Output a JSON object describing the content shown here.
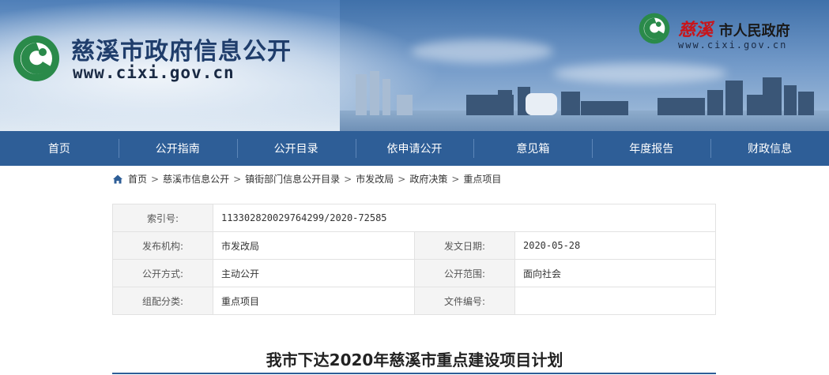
{
  "header": {
    "site_title": "慈溪市政府信息公开",
    "site_url": "www.cixi.gov.cn",
    "city_calligraphy": "慈溪",
    "city_gov": "市人民政府",
    "city_url": "www.cixi.gov.cn",
    "logo_icon": "cixi-logo-icon"
  },
  "nav": {
    "items": [
      {
        "label": "首页"
      },
      {
        "label": "公开指南"
      },
      {
        "label": "公开目录"
      },
      {
        "label": "依申请公开"
      },
      {
        "label": "意见箱"
      },
      {
        "label": "年度报告"
      },
      {
        "label": "财政信息"
      }
    ]
  },
  "breadcrumb": {
    "icon": "home-icon",
    "items": [
      "首页",
      "慈溪市信息公开",
      "镇街部门信息公开目录",
      "市发改局",
      "政府决策",
      "重点项目"
    ]
  },
  "meta": {
    "index_label": "索引号:",
    "index_value": "113302820029764299/2020-72585",
    "org_label": "发布机构:",
    "org_value": "市发改局",
    "date_label": "发文日期:",
    "date_value": "2020-05-28",
    "method_label": "公开方式:",
    "method_value": "主动公开",
    "scope_label": "公开范围:",
    "scope_value": "面向社会",
    "category_label": "组配分类:",
    "category_value": "重点项目",
    "docno_label": "文件编号:",
    "docno_value": ""
  },
  "article": {
    "title": "我市下达2020年慈溪市重点建设项目计划"
  },
  "colors": {
    "nav_bg": "#2e5e97",
    "title_blue": "#1f3d6b",
    "calligraphy_red": "#c8151b"
  }
}
